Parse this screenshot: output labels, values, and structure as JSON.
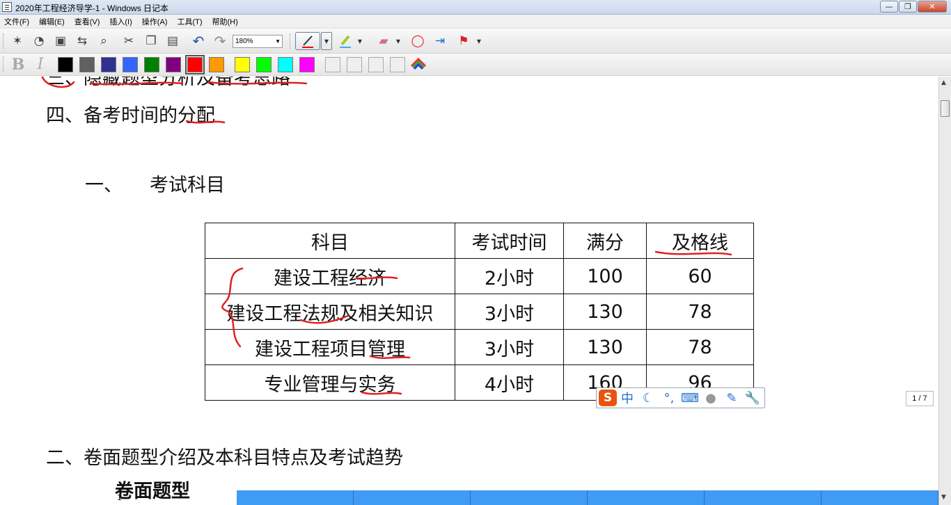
{
  "window": {
    "title": "2020年工程经济导学-1 - Windows 日记本",
    "buttons": {
      "minimize": "—",
      "maximize": "❐",
      "close": "✕"
    }
  },
  "menu": [
    "文件(F)",
    "编辑(E)",
    "查看(V)",
    "插入(I)",
    "操作(A)",
    "工具(T)",
    "帮助(H)"
  ],
  "toolbar": {
    "zoom": "180%",
    "icons": [
      "new-note-icon",
      "templates-icon",
      "save-icon",
      "find-icon",
      "zoom-icon",
      "cut-icon",
      "copy-icon",
      "paste-icon",
      "undo-icon",
      "redo-icon",
      "pen-icon",
      "highlighter-icon",
      "eraser-icon",
      "lasso-icon",
      "insert-space-icon",
      "flag-icon"
    ]
  },
  "format_bar": {
    "bold": "B",
    "italic": "I",
    "colors": [
      "#000000",
      "#606060",
      "#303090",
      "#3366ff",
      "#008000",
      "#800080",
      "#ff0000",
      "#ff9900",
      "#ffff00",
      "#00ff00",
      "#00ffff",
      "#ff00ff"
    ],
    "selected_color": "#ff0000"
  },
  "document": {
    "partial_line": "三、隐藏题型分析及备考思路",
    "line4": "四、备考时间的分配",
    "section1_num": "一、",
    "section1_title": "考试科目",
    "table": {
      "headers": [
        "科目",
        "考试时间",
        "满分",
        "及格线"
      ],
      "rows": [
        [
          "建设工程经济",
          "2小时",
          "100",
          "60"
        ],
        [
          "建设工程法规及相关知识",
          "3小时",
          "130",
          "78"
        ],
        [
          "建设工程项目管理",
          "3小时",
          "130",
          "78"
        ],
        [
          "专业管理与实务",
          "4小时",
          "160",
          "96"
        ]
      ]
    },
    "section2": "二、卷面题型介绍及本科目特点及考试趋势",
    "subheading": "卷面题型",
    "small_number": "1"
  },
  "ime": {
    "logo": "S",
    "mode": "中"
  },
  "page_indicator": "1 / 7"
}
